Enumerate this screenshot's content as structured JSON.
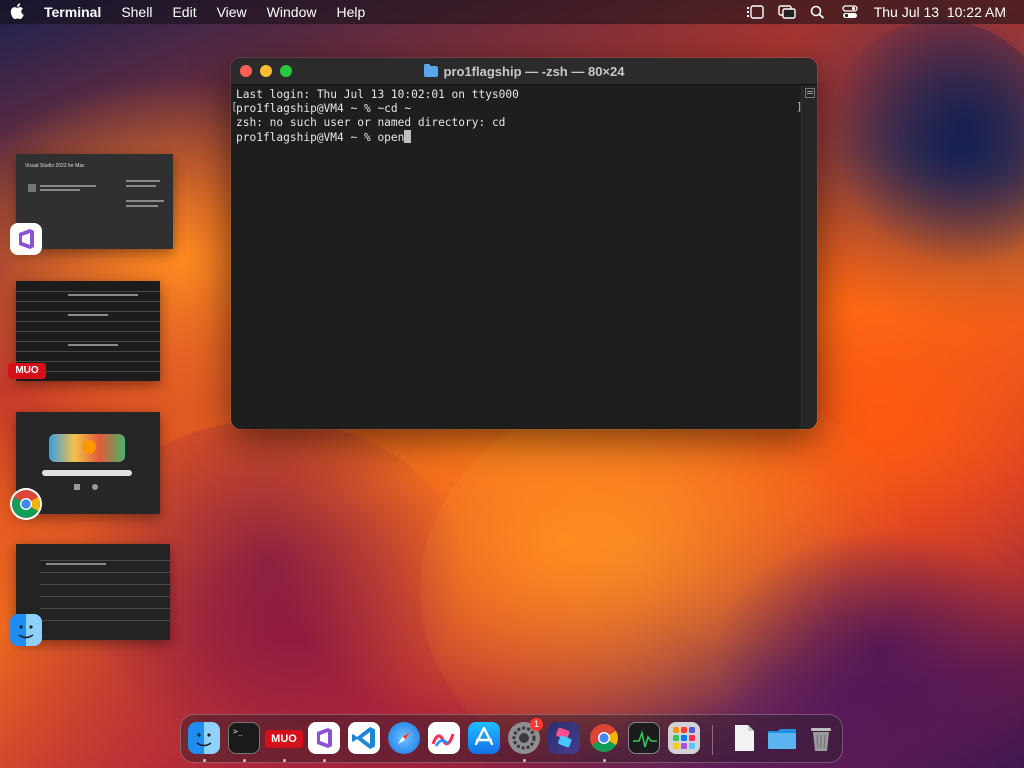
{
  "menubar": {
    "app_name": "Terminal",
    "menus": [
      "Shell",
      "Edit",
      "View",
      "Window",
      "Help"
    ],
    "clock": "Thu Jul 13  10:22 AM"
  },
  "terminal": {
    "title": "pro1flagship — -zsh — 80×24",
    "lines": [
      "Last login: Thu Jul 13 10:02:01 on ttys000",
      "pro1flagship@VM4 ~ % ~cd ~",
      "zsh: no such user or named directory: cd",
      "pro1flagship@VM4 ~ % open"
    ]
  },
  "stage": {
    "thumb1_title": "Visual Studio 2022 for Mac",
    "muo_label": "MUO"
  },
  "dock": {
    "muo_label": "MUO",
    "settings_badge": "1",
    "terminal_prompt": ">_"
  }
}
